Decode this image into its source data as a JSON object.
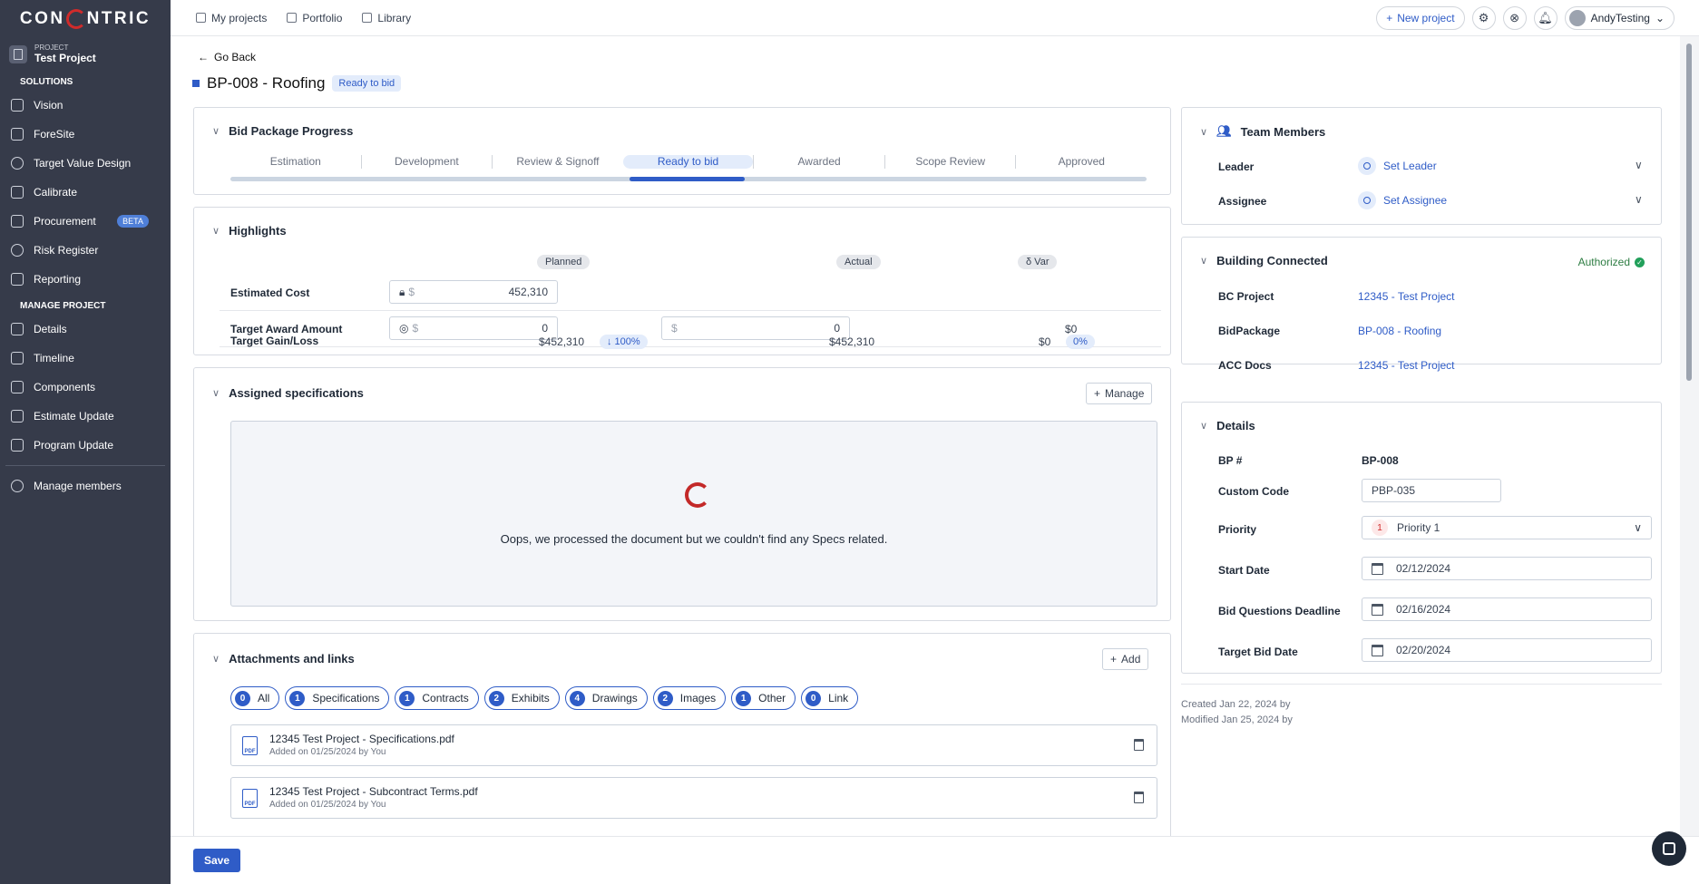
{
  "brand": {
    "logo_left": "CON",
    "logo_right": "NTRIC"
  },
  "sidebar": {
    "project_caption": "PROJECT",
    "project_name": "Test Project",
    "section_solutions": "SOLUTIONS",
    "solutions": [
      {
        "label": "Vision",
        "icon": "vision-icon"
      },
      {
        "label": "ForeSite",
        "icon": "foresite-icon"
      },
      {
        "label": "Target Value Design",
        "icon": "target-icon"
      },
      {
        "label": "Calibrate",
        "icon": "calibrate-icon"
      },
      {
        "label": "Procurement",
        "icon": "procurement-icon",
        "badge": "BETA"
      },
      {
        "label": "Risk Register",
        "icon": "risk-icon"
      },
      {
        "label": "Reporting",
        "icon": "reporting-icon"
      }
    ],
    "section_manage": "MANAGE PROJECT",
    "manage": [
      {
        "label": "Details"
      },
      {
        "label": "Timeline"
      },
      {
        "label": "Components"
      },
      {
        "label": "Estimate Update"
      },
      {
        "label": "Program Update"
      }
    ],
    "members": "Manage members"
  },
  "topbar": {
    "my_projects": "My projects",
    "portfolio": "Portfolio",
    "library": "Library",
    "new_project": "New project",
    "user": "AndyTesting"
  },
  "page": {
    "go_back": "Go Back",
    "title": "BP-008 - Roofing",
    "status": "Ready to bid",
    "accent_color": "#2f5cc7"
  },
  "progress": {
    "title": "Bid Package Progress",
    "steps": [
      "Estimation",
      "Development",
      "Review & Signoff",
      "Ready to bid",
      "Awarded",
      "Scope Review",
      "Approved"
    ],
    "active_index": 3
  },
  "highlights": {
    "title": "Highlights",
    "col_planned": "Planned",
    "col_actual": "Actual",
    "col_var": "δ Var",
    "rows": {
      "estimated_cost": {
        "label": "Estimated Cost",
        "currency": "$",
        "planned": "452,310"
      },
      "target_award": {
        "label": "Target Award Amount",
        "currency": "$",
        "planned": "0",
        "actual": "0",
        "var": "$0"
      },
      "gain_loss": {
        "label": "Target Gain/Loss",
        "planned": "$452,310",
        "planned_pct": "↓ 100%",
        "actual": "$452,310",
        "var": "$0",
        "var_pct": "0%"
      }
    }
  },
  "specs": {
    "title": "Assigned specifications",
    "manage": "Manage",
    "empty_msg": "Oops, we processed the document but we couldn't find any Specs related."
  },
  "attachments": {
    "title": "Attachments and links",
    "add": "Add",
    "chips": [
      {
        "count": "0",
        "label": "All"
      },
      {
        "count": "1",
        "label": "Specifications"
      },
      {
        "count": "1",
        "label": "Contracts"
      },
      {
        "count": "2",
        "label": "Exhibits"
      },
      {
        "count": "4",
        "label": "Drawings"
      },
      {
        "count": "2",
        "label": "Images"
      },
      {
        "count": "1",
        "label": "Other"
      },
      {
        "count": "0",
        "label": "Link"
      }
    ],
    "files": [
      {
        "name": "12345 Test Project - Specifications.pdf",
        "added": "Added on 01/25/2024 by You"
      },
      {
        "name": "12345 Test Project - Subcontract Terms.pdf",
        "added": "Added on 01/25/2024 by You"
      }
    ]
  },
  "team": {
    "title": "Team Members",
    "leader_label": "Leader",
    "leader_value": "Set Leader",
    "assignee_label": "Assignee",
    "assignee_value": "Set Assignee"
  },
  "bc": {
    "title": "Building Connected",
    "status": "Authorized",
    "bc_project_label": "BC Project",
    "bc_project_value": "12345 - Test Project",
    "bidpackage_label": "BidPackage",
    "bidpackage_value": "BP-008 - Roofing",
    "acc_label": "ACC Docs",
    "acc_value": "12345 - Test Project"
  },
  "details": {
    "title": "Details",
    "bp_label": "BP #",
    "bp_value": "BP-008",
    "code_label": "Custom Code",
    "code_value": "PBP-035",
    "priority_label": "Priority",
    "priority_num": "1",
    "priority_value": "Priority 1",
    "start_label": "Start Date",
    "start_value": "02/12/2024",
    "bq_label": "Bid Questions Deadline",
    "bq_value": "02/16/2024",
    "target_label": "Target Bid Date",
    "target_value": "02/20/2024",
    "created": "Created Jan 22, 2024 by",
    "modified": "Modified Jan 25, 2024 by"
  },
  "footer": {
    "save": "Save"
  }
}
